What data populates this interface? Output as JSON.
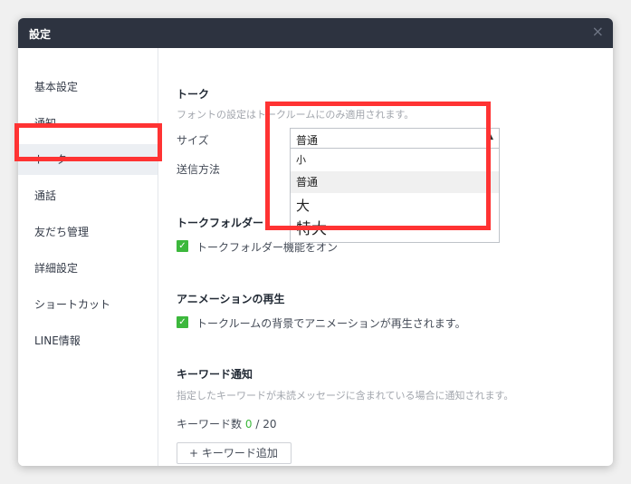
{
  "window": {
    "title": "設定",
    "close_icon": "×"
  },
  "sidebar": {
    "items": [
      {
        "label": "基本設定"
      },
      {
        "label": "通知"
      },
      {
        "label": "トーク"
      },
      {
        "label": "通話"
      },
      {
        "label": "友だち管理"
      },
      {
        "label": "詳細設定"
      },
      {
        "label": "ショートカット"
      },
      {
        "label": "LINE情報"
      }
    ],
    "active": "トーク"
  },
  "talk": {
    "heading": "トーク",
    "description": "フォントの設定はトークルームにのみ適用されます。",
    "size_label": "サイズ",
    "send_label": "送信方法",
    "size_select": {
      "value": "普通",
      "options": [
        "小",
        "普通",
        "大",
        "特大"
      ]
    }
  },
  "folder": {
    "heading": "トークフォルダー",
    "checkbox_label": "トークフォルダー機能をオン",
    "checked": true
  },
  "animation": {
    "heading": "アニメーションの再生",
    "checkbox_label": "トークルームの背景でアニメーションが再生されます。",
    "checked": true
  },
  "keyword": {
    "heading": "キーワード通知",
    "description": "指定したキーワードが未読メッセージに含まれている場合に通知されます。",
    "count_label": "キーワード数",
    "count": "0",
    "separator": "/",
    "max": "20",
    "add_button": "+ キーワード追加"
  },
  "colors": {
    "titlebar": "#2d3340",
    "accent_green": "#3cb83c",
    "highlight_red": "#ff3333"
  }
}
